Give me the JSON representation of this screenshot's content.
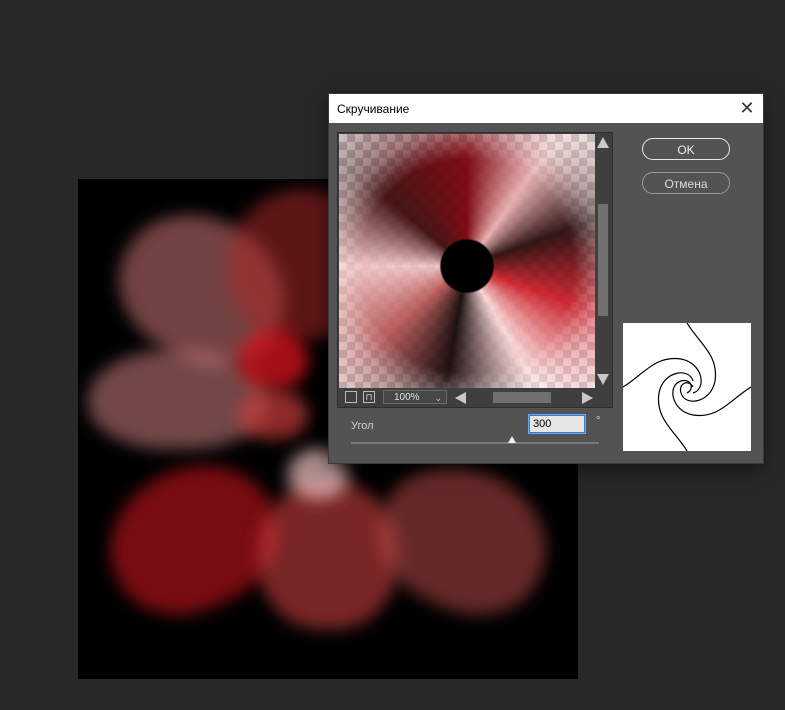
{
  "dialog": {
    "title": "Скручивание",
    "ok_label": "OK",
    "cancel_label": "Отмена",
    "zoom": "100%",
    "angle_label": "Угол",
    "angle_value": "300",
    "degree_symbol": "°",
    "slider_fraction": 0.65
  },
  "icons": {
    "close": "close-icon",
    "zoom_out": "zoom-out-icon",
    "zoom_in": "zoom-in-icon",
    "dropdown": "chevron-down-icon"
  },
  "colors": {
    "workspace": "#282828",
    "dialog_bg": "#535353",
    "accent_focus": "#3b7bd4"
  }
}
